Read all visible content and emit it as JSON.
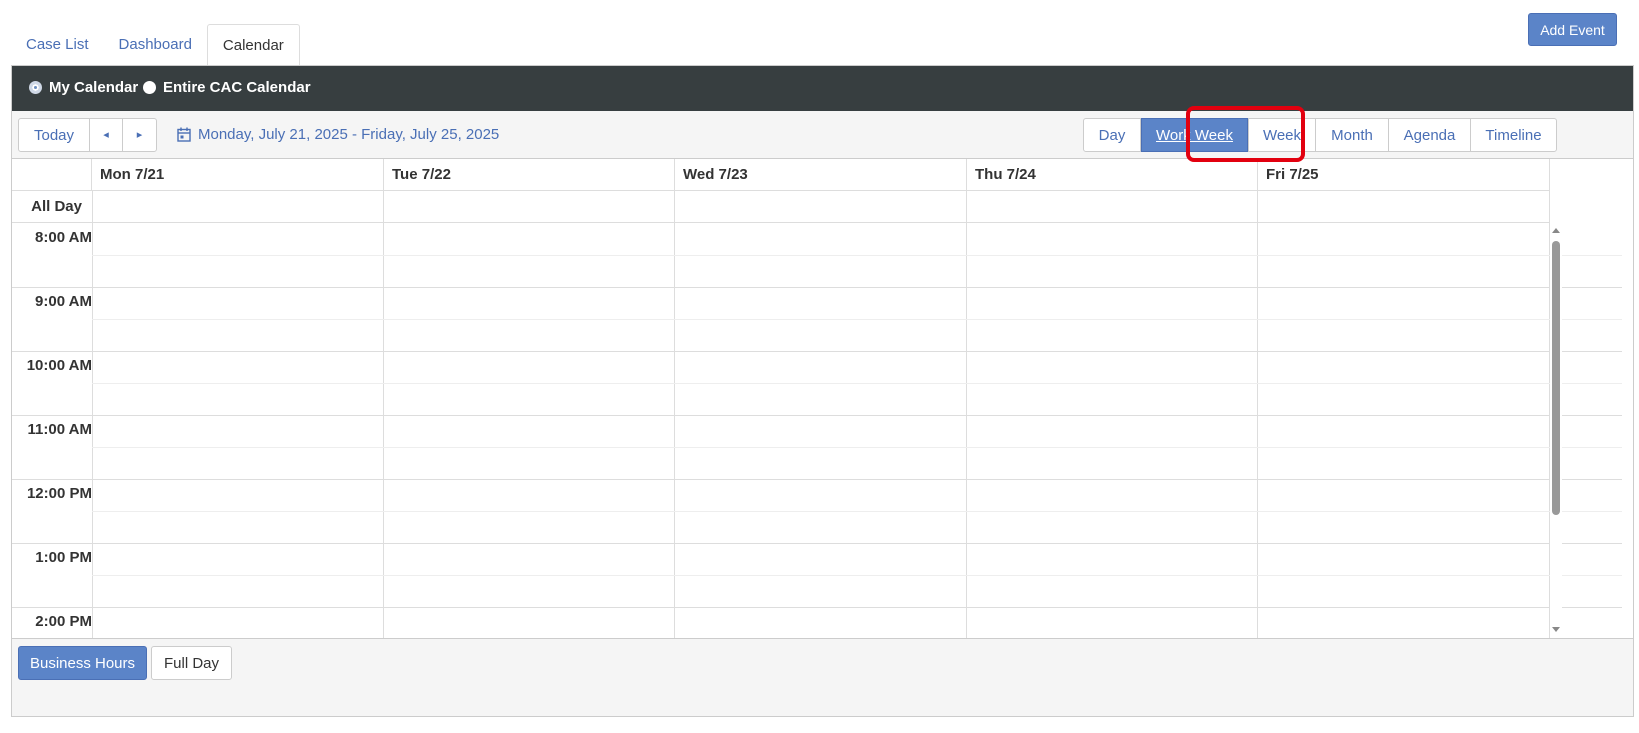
{
  "tabs": [
    {
      "label": "Case List"
    },
    {
      "label": "Dashboard"
    },
    {
      "label": "Calendar"
    }
  ],
  "add_event_label": "Add Event",
  "calendar_filter": {
    "my_calendar": "My Calendar",
    "entire_calendar": "Entire CAC Calendar",
    "selected": "My Calendar"
  },
  "toolbar": {
    "today": "Today",
    "prev": "◂",
    "next": "▸",
    "date_range": "Monday, July 21, 2025 - Friday, July 25, 2025",
    "views": [
      "Day",
      "Work Week",
      "Week",
      "Month",
      "Agenda",
      "Timeline"
    ],
    "selected_view": "Work Week"
  },
  "grid": {
    "days": [
      "Mon 7/21",
      "Tue 7/22",
      "Wed 7/23",
      "Thu 7/24",
      "Fri 7/25"
    ],
    "all_day_label": "All Day",
    "times": [
      "8:00 AM",
      "9:00 AM",
      "10:00 AM",
      "11:00 AM",
      "12:00 PM",
      "1:00 PM",
      "2:00 PM"
    ]
  },
  "footer": {
    "business_hours": "Business Hours",
    "full_day": "Full Day"
  },
  "colors": {
    "accent": "#5b84c8",
    "dark_bar": "#373e40",
    "highlight": "#e2000f",
    "link": "#4a6fb5"
  }
}
